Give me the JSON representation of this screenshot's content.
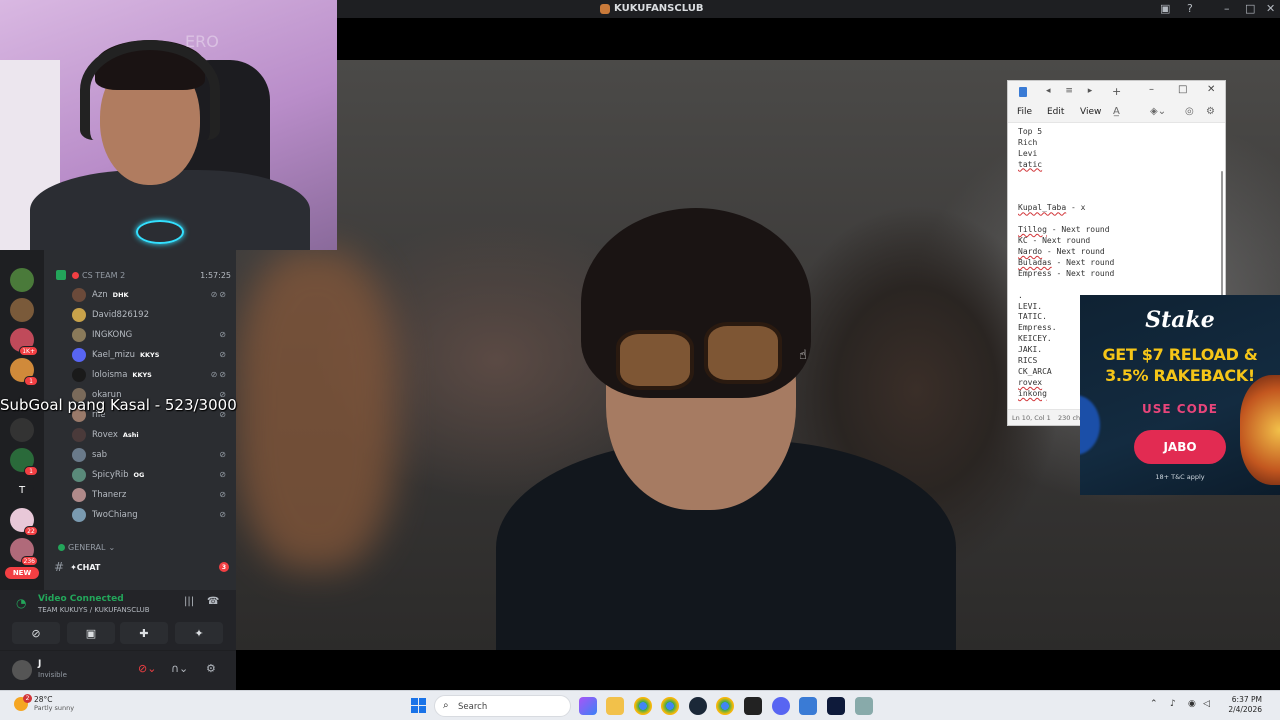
{
  "window": {
    "title": "KUKUFANSCLUB"
  },
  "webcam": {
    "watermark": "ERO"
  },
  "voice_channel": {
    "name": "CS TEAM 2",
    "timer": "1:57:25",
    "members": [
      {
        "name": "Azn",
        "tag": "DHK",
        "avatar_color": "#6b4a3a"
      },
      {
        "name": "David826192",
        "tag": "",
        "avatar_color": "#c8a24a"
      },
      {
        "name": "INGKONG",
        "tag": "",
        "avatar_color": "#8a7a5a"
      },
      {
        "name": "Kael_mizu",
        "tag": "KKYS",
        "avatar_color": "#5865f2"
      },
      {
        "name": "loloisma",
        "tag": "KKYS",
        "avatar_color": "#1a1a1a"
      },
      {
        "name": "okarun",
        "tag": "",
        "avatar_color": "#7a6a5a"
      },
      {
        "name": "rile",
        "tag": "",
        "avatar_color": "#9a7a6a"
      },
      {
        "name": "Rovex",
        "tag": "Ashi",
        "avatar_color": "#4a3a3a"
      },
      {
        "name": "sab",
        "tag": "",
        "avatar_color": "#6a7a8a"
      },
      {
        "name": "SpicyRib",
        "tag": "OG",
        "avatar_color": "#5a8a7a"
      },
      {
        "name": "Thanerz",
        "tag": "",
        "avatar_color": "#b08a8a"
      },
      {
        "name": "TwoChiang",
        "tag": "",
        "avatar_color": "#7a9ab0"
      }
    ]
  },
  "server_rail": {
    "badges": [
      "1K+",
      "1",
      "1",
      "22",
      "236"
    ],
    "text_server": "T",
    "new_label": "NEW"
  },
  "category": {
    "name": "GENERAL"
  },
  "text_channel": {
    "name": "✦CHAT",
    "unread": "3"
  },
  "overlay": {
    "subgoal": "SubGoal pang Kasal - 523/3000"
  },
  "voice_panel": {
    "status": "Video Connected",
    "path": "TEAM KUKUYS / KUKUFANSCLUB"
  },
  "user_panel": {
    "name": "J",
    "status": "Invisible"
  },
  "notepad": {
    "menu": [
      "File",
      "Edit",
      "View"
    ],
    "lines": [
      {
        "text": "Top 5",
        "squiggle": false
      },
      {
        "text": "Rich",
        "squiggle": false
      },
      {
        "text": "Levi",
        "squiggle": false
      },
      {
        "text": "tatic",
        "squiggle": true
      },
      {
        "text": "",
        "squiggle": false
      },
      {
        "text": "",
        "squiggle": false
      },
      {
        "text": "",
        "squiggle": false
      },
      {
        "text": "Kupal_Taba - x",
        "squiggle": true
      },
      {
        "text": "",
        "squiggle": false
      },
      {
        "text": "Tillog - Next round",
        "squiggle": true
      },
      {
        "text": "KC - Next round",
        "squiggle": false
      },
      {
        "text": "Nardo - Next round",
        "squiggle": true
      },
      {
        "text": "Buladas - Next round",
        "squiggle": true
      },
      {
        "text": "Empress - Next round",
        "squiggle": false
      },
      {
        "text": "",
        "squiggle": false
      },
      {
        "text": ".",
        "squiggle": false
      },
      {
        "text": "LEVI.",
        "squiggle": false
      },
      {
        "text": "TATIC.",
        "squiggle": false
      },
      {
        "text": "Empress.",
        "squiggle": false
      },
      {
        "text": "KEICEY.",
        "squiggle": false
      },
      {
        "text": "JAKI.",
        "squiggle": false
      },
      {
        "text": "RICS",
        "squiggle": false
      },
      {
        "text": "CK_ARCA",
        "squiggle": false
      },
      {
        "text": "rovex",
        "squiggle": true
      },
      {
        "text": "inkong",
        "squiggle": true
      }
    ],
    "status_position": "Ln 10, Col 1",
    "status_chars": "230 ch"
  },
  "ad": {
    "brand": "Stake",
    "headline_1": "GET $7 RELOAD &",
    "headline_2": "3.5% RAKEBACK!",
    "code_label": "USE CODE",
    "code": "JABO",
    "terms": "18+ T&C apply",
    "accent": "#f5c518"
  },
  "taskbar": {
    "temperature": "28°C",
    "weather": "Partly sunny",
    "weather_badge": "2",
    "search_placeholder": "Search",
    "time": "6:37 PM",
    "date": "2/4/2026"
  }
}
